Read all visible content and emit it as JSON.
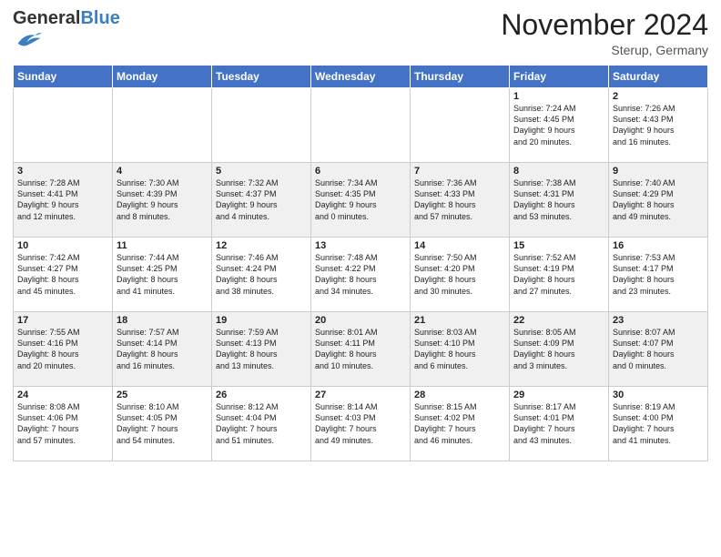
{
  "header": {
    "logo_general": "General",
    "logo_blue": "Blue",
    "month_title": "November 2024",
    "location": "Sterup, Germany"
  },
  "weekdays": [
    "Sunday",
    "Monday",
    "Tuesday",
    "Wednesday",
    "Thursday",
    "Friday",
    "Saturday"
  ],
  "weeks": [
    [
      {
        "day": "",
        "info": ""
      },
      {
        "day": "",
        "info": ""
      },
      {
        "day": "",
        "info": ""
      },
      {
        "day": "",
        "info": ""
      },
      {
        "day": "",
        "info": ""
      },
      {
        "day": "1",
        "info": "Sunrise: 7:24 AM\nSunset: 4:45 PM\nDaylight: 9 hours\nand 20 minutes."
      },
      {
        "day": "2",
        "info": "Sunrise: 7:26 AM\nSunset: 4:43 PM\nDaylight: 9 hours\nand 16 minutes."
      }
    ],
    [
      {
        "day": "3",
        "info": "Sunrise: 7:28 AM\nSunset: 4:41 PM\nDaylight: 9 hours\nand 12 minutes."
      },
      {
        "day": "4",
        "info": "Sunrise: 7:30 AM\nSunset: 4:39 PM\nDaylight: 9 hours\nand 8 minutes."
      },
      {
        "day": "5",
        "info": "Sunrise: 7:32 AM\nSunset: 4:37 PM\nDaylight: 9 hours\nand 4 minutes."
      },
      {
        "day": "6",
        "info": "Sunrise: 7:34 AM\nSunset: 4:35 PM\nDaylight: 9 hours\nand 0 minutes."
      },
      {
        "day": "7",
        "info": "Sunrise: 7:36 AM\nSunset: 4:33 PM\nDaylight: 8 hours\nand 57 minutes."
      },
      {
        "day": "8",
        "info": "Sunrise: 7:38 AM\nSunset: 4:31 PM\nDaylight: 8 hours\nand 53 minutes."
      },
      {
        "day": "9",
        "info": "Sunrise: 7:40 AM\nSunset: 4:29 PM\nDaylight: 8 hours\nand 49 minutes."
      }
    ],
    [
      {
        "day": "10",
        "info": "Sunrise: 7:42 AM\nSunset: 4:27 PM\nDaylight: 8 hours\nand 45 minutes."
      },
      {
        "day": "11",
        "info": "Sunrise: 7:44 AM\nSunset: 4:25 PM\nDaylight: 8 hours\nand 41 minutes."
      },
      {
        "day": "12",
        "info": "Sunrise: 7:46 AM\nSunset: 4:24 PM\nDaylight: 8 hours\nand 38 minutes."
      },
      {
        "day": "13",
        "info": "Sunrise: 7:48 AM\nSunset: 4:22 PM\nDaylight: 8 hours\nand 34 minutes."
      },
      {
        "day": "14",
        "info": "Sunrise: 7:50 AM\nSunset: 4:20 PM\nDaylight: 8 hours\nand 30 minutes."
      },
      {
        "day": "15",
        "info": "Sunrise: 7:52 AM\nSunset: 4:19 PM\nDaylight: 8 hours\nand 27 minutes."
      },
      {
        "day": "16",
        "info": "Sunrise: 7:53 AM\nSunset: 4:17 PM\nDaylight: 8 hours\nand 23 minutes."
      }
    ],
    [
      {
        "day": "17",
        "info": "Sunrise: 7:55 AM\nSunset: 4:16 PM\nDaylight: 8 hours\nand 20 minutes."
      },
      {
        "day": "18",
        "info": "Sunrise: 7:57 AM\nSunset: 4:14 PM\nDaylight: 8 hours\nand 16 minutes."
      },
      {
        "day": "19",
        "info": "Sunrise: 7:59 AM\nSunset: 4:13 PM\nDaylight: 8 hours\nand 13 minutes."
      },
      {
        "day": "20",
        "info": "Sunrise: 8:01 AM\nSunset: 4:11 PM\nDaylight: 8 hours\nand 10 minutes."
      },
      {
        "day": "21",
        "info": "Sunrise: 8:03 AM\nSunset: 4:10 PM\nDaylight: 8 hours\nand 6 minutes."
      },
      {
        "day": "22",
        "info": "Sunrise: 8:05 AM\nSunset: 4:09 PM\nDaylight: 8 hours\nand 3 minutes."
      },
      {
        "day": "23",
        "info": "Sunrise: 8:07 AM\nSunset: 4:07 PM\nDaylight: 8 hours\nand 0 minutes."
      }
    ],
    [
      {
        "day": "24",
        "info": "Sunrise: 8:08 AM\nSunset: 4:06 PM\nDaylight: 7 hours\nand 57 minutes."
      },
      {
        "day": "25",
        "info": "Sunrise: 8:10 AM\nSunset: 4:05 PM\nDaylight: 7 hours\nand 54 minutes."
      },
      {
        "day": "26",
        "info": "Sunrise: 8:12 AM\nSunset: 4:04 PM\nDaylight: 7 hours\nand 51 minutes."
      },
      {
        "day": "27",
        "info": "Sunrise: 8:14 AM\nSunset: 4:03 PM\nDaylight: 7 hours\nand 49 minutes."
      },
      {
        "day": "28",
        "info": "Sunrise: 8:15 AM\nSunset: 4:02 PM\nDaylight: 7 hours\nand 46 minutes."
      },
      {
        "day": "29",
        "info": "Sunrise: 8:17 AM\nSunset: 4:01 PM\nDaylight: 7 hours\nand 43 minutes."
      },
      {
        "day": "30",
        "info": "Sunrise: 8:19 AM\nSunset: 4:00 PM\nDaylight: 7 hours\nand 41 minutes."
      }
    ]
  ]
}
